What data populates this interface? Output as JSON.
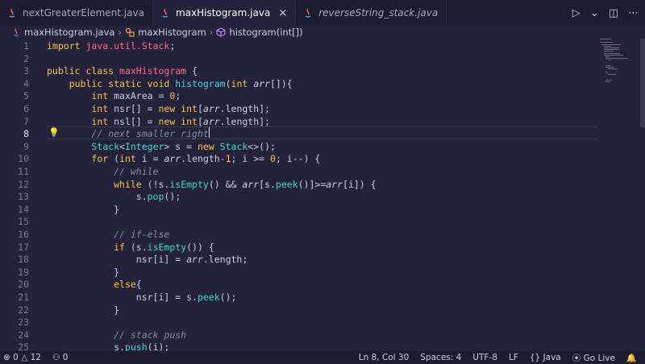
{
  "tabs": [
    {
      "label": "nextGreaterElement.java",
      "state": "inactive"
    },
    {
      "label": "maxHistogram.java",
      "state": "active",
      "close": "×"
    },
    {
      "label": "reverseString_stack.java",
      "state": "preview"
    }
  ],
  "tab_actions": {
    "run": "▷",
    "run_dropdown": "⌄",
    "split": "◫",
    "more": "⋯"
  },
  "breadcrumb": {
    "file": "maxHistogram.java",
    "class": "maxHistogram",
    "method": "histogram(int[])",
    "separator": "›"
  },
  "line_numbers": [
    "1",
    "2",
    "3",
    "4",
    "5",
    "6",
    "7",
    "8",
    "9",
    "10",
    "11",
    "12",
    "13",
    "14",
    "15",
    "16",
    "17",
    "18",
    "19",
    "20",
    "21",
    "22",
    "23",
    "24",
    "25"
  ],
  "active_line": "8",
  "code_lines": [
    [
      [
        "kw",
        "import "
      ],
      [
        "pkg",
        "java.util.Stack"
      ],
      [
        "pun",
        ";"
      ]
    ],
    [],
    [
      [
        "kw",
        "public class "
      ],
      [
        "cls",
        "maxHistogram "
      ],
      [
        "pun",
        "{"
      ]
    ],
    [
      [
        "pun",
        "    "
      ],
      [
        "kw",
        "public static void "
      ],
      [
        "fn",
        "histogram"
      ],
      [
        "pun",
        "("
      ],
      [
        "kw",
        "int "
      ],
      [
        "param",
        "arr"
      ],
      [
        "pun",
        "[]){"
      ]
    ],
    [
      [
        "pun",
        "        "
      ],
      [
        "kw",
        "int "
      ],
      [
        "pun",
        "maxArea = "
      ],
      [
        "num",
        "0"
      ],
      [
        "pun",
        ";"
      ]
    ],
    [
      [
        "pun",
        "        "
      ],
      [
        "kw",
        "int "
      ],
      [
        "pun",
        "nsr[] = "
      ],
      [
        "kw",
        "new int"
      ],
      [
        "pun",
        "["
      ],
      [
        "param",
        "arr"
      ],
      [
        "pun",
        ".length];"
      ]
    ],
    [
      [
        "pun",
        "        "
      ],
      [
        "kw",
        "int "
      ],
      [
        "pun",
        "nsl[] = "
      ],
      [
        "kw",
        "new int"
      ],
      [
        "pun",
        "["
      ],
      [
        "param",
        "arr"
      ],
      [
        "pun",
        ".length];"
      ]
    ],
    [
      [
        "pun",
        "        "
      ],
      [
        "cmt",
        "// next smaller right"
      ]
    ],
    [
      [
        "pun",
        "        "
      ],
      [
        "typ",
        "Stack"
      ],
      [
        "pun",
        "<"
      ],
      [
        "typ",
        "Integer"
      ],
      [
        "pun",
        "> s = "
      ],
      [
        "kw",
        "new "
      ],
      [
        "typ",
        "Stack"
      ],
      [
        "pun",
        "<>();"
      ]
    ],
    [
      [
        "pun",
        "        "
      ],
      [
        "kw",
        "for "
      ],
      [
        "pun",
        "("
      ],
      [
        "kw",
        "int "
      ],
      [
        "pun",
        "i = "
      ],
      [
        "param",
        "arr"
      ],
      [
        "pun",
        ".length-"
      ],
      [
        "num",
        "1"
      ],
      [
        "pun",
        "; i >= "
      ],
      [
        "num",
        "0"
      ],
      [
        "pun",
        "; i--) {"
      ]
    ],
    [
      [
        "pun",
        "            "
      ],
      [
        "cmt",
        "// while"
      ]
    ],
    [
      [
        "pun",
        "            "
      ],
      [
        "kw",
        "while "
      ],
      [
        "pun",
        "(!s."
      ],
      [
        "fn",
        "isEmpty"
      ],
      [
        "pun",
        "() && "
      ],
      [
        "param",
        "arr"
      ],
      [
        "pun",
        "[s."
      ],
      [
        "fn",
        "peek"
      ],
      [
        "pun",
        "()]>="
      ],
      [
        "param",
        "arr"
      ],
      [
        "pun",
        "[i]) {"
      ]
    ],
    [
      [
        "pun",
        "                s."
      ],
      [
        "fn",
        "pop"
      ],
      [
        "pun",
        "();"
      ]
    ],
    [
      [
        "pun",
        "            }"
      ]
    ],
    [],
    [
      [
        "pun",
        "            "
      ],
      [
        "cmt",
        "// if-else"
      ]
    ],
    [
      [
        "pun",
        "            "
      ],
      [
        "kw",
        "if "
      ],
      [
        "pun",
        "(s."
      ],
      [
        "fn",
        "isEmpty"
      ],
      [
        "pun",
        "()) {"
      ]
    ],
    [
      [
        "pun",
        "                nsr[i] = "
      ],
      [
        "param",
        "arr"
      ],
      [
        "pun",
        ".length;"
      ]
    ],
    [
      [
        "pun",
        "            }"
      ]
    ],
    [
      [
        "pun",
        "            "
      ],
      [
        "kw",
        "else"
      ],
      [
        "pun",
        "{"
      ]
    ],
    [
      [
        "pun",
        "                nsr[i] = s."
      ],
      [
        "fn",
        "peek"
      ],
      [
        "pun",
        "();"
      ]
    ],
    [
      [
        "pun",
        "            }"
      ]
    ],
    [],
    [
      [
        "pun",
        "            "
      ],
      [
        "cmt",
        "// stack push"
      ]
    ],
    [
      [
        "pun",
        "            s."
      ],
      [
        "fn",
        "push"
      ],
      [
        "pun",
        "(i);"
      ]
    ]
  ],
  "statusbar": {
    "errors": "0",
    "warnings": "12",
    "ports": "0",
    "position": "Ln 8, Col 30",
    "spaces": "Spaces: 4",
    "encoding": "UTF-8",
    "eol": "LF",
    "language_icon": "{}",
    "language": "Java",
    "golive": "Go Live"
  },
  "colors": {
    "editor_bg": "#24213a",
    "keyword": "#f3c845",
    "class_name": "#ff6b8b",
    "function": "#42d9d3",
    "comment": "#8c88a8"
  }
}
